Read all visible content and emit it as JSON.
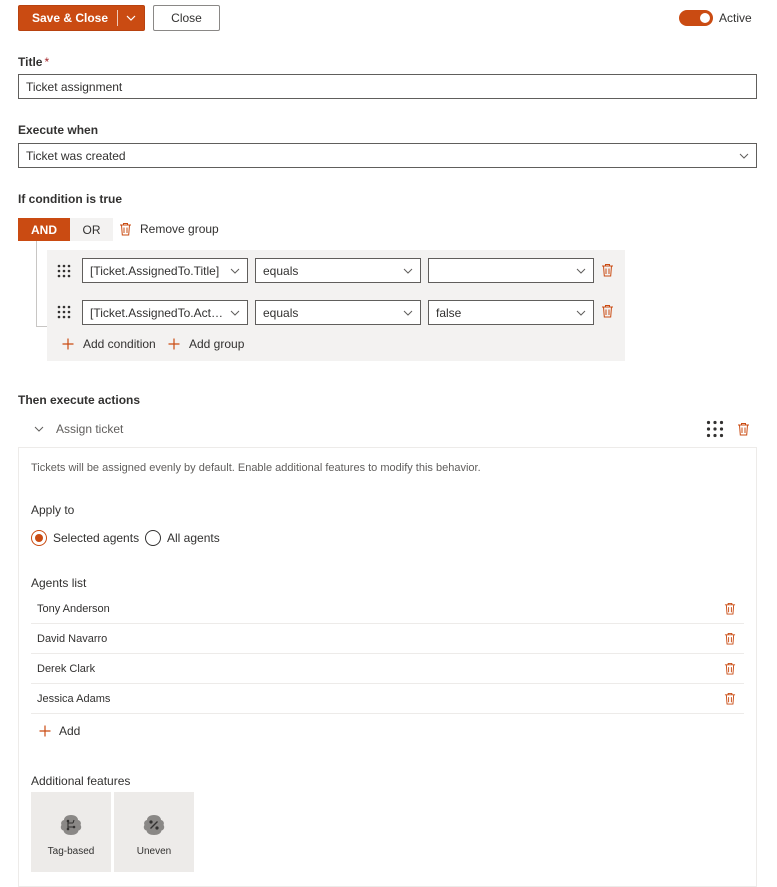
{
  "toolbar": {
    "save_close_label": "Save & Close",
    "close_label": "Close",
    "active_label": "Active",
    "active_on": true
  },
  "title_field": {
    "label": "Title",
    "required_mark": "*",
    "value": "Ticket assignment"
  },
  "execute_when": {
    "label": "Execute when",
    "value": "Ticket was created"
  },
  "condition": {
    "label": "If condition is true",
    "and_label": "AND",
    "or_label": "OR",
    "remove_group_label": "Remove group",
    "rows": [
      {
        "field": "[Ticket.AssignedTo.Title]",
        "operator": "equals",
        "value": ""
      },
      {
        "field": "[Ticket.AssignedTo.Activ...",
        "operator": "equals",
        "value": "false"
      }
    ],
    "add_condition_label": "Add condition",
    "add_group_label": "Add group"
  },
  "actions": {
    "label": "Then execute actions",
    "action_title": "Assign ticket",
    "description": "Tickets will be assigned evenly by default. Enable additional features to modify this behavior.",
    "apply_to_label": "Apply to",
    "apply_options": [
      "Selected agents",
      "All agents"
    ],
    "apply_selected": "Selected agents",
    "agents_list_label": "Agents list",
    "agents": [
      "Tony Anderson",
      "David Navarro",
      "Derek Clark",
      "Jessica Adams"
    ],
    "add_label": "Add",
    "additional_features_label": "Additional features",
    "features": [
      "Tag-based",
      "Uneven"
    ]
  },
  "colors": {
    "accent": "#ca4b12",
    "border": "#605e5c",
    "panel_bg": "#f3f2f1"
  }
}
